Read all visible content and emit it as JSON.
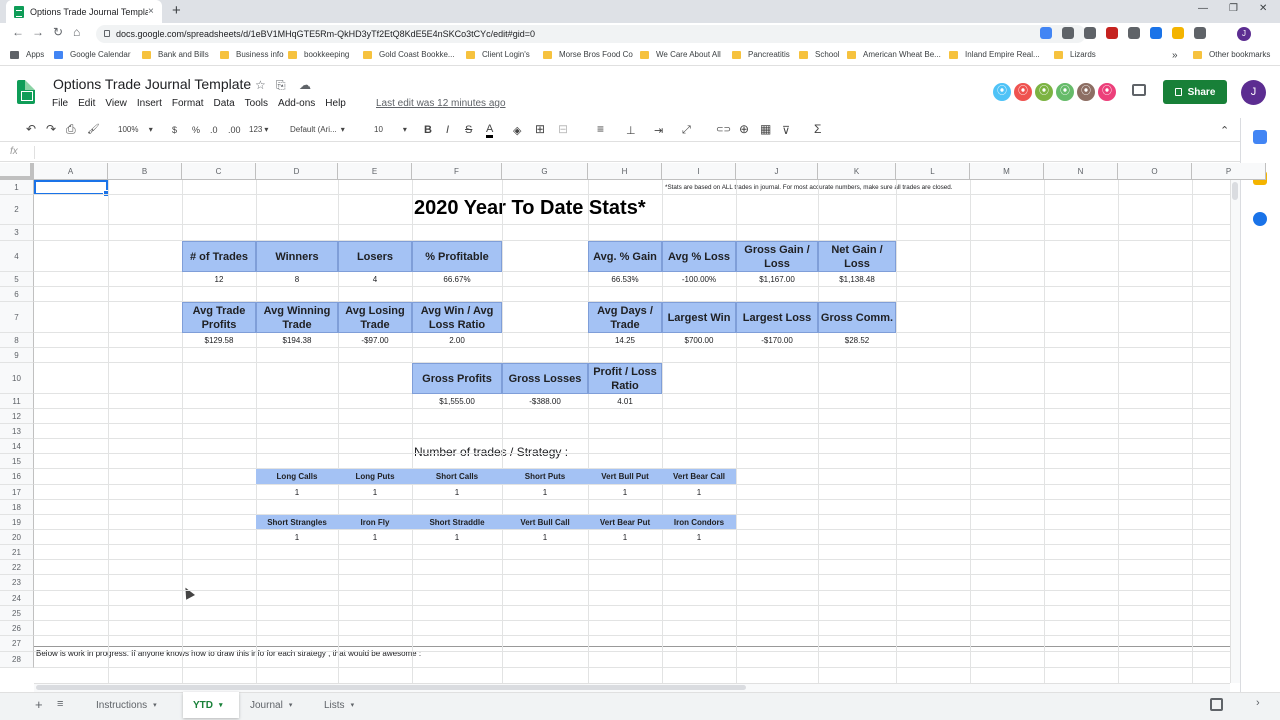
{
  "browser": {
    "tab_title": "Options Trade Journal Template",
    "tab_close": "×",
    "new_tab": "+",
    "win_controls": [
      "—",
      "❐",
      "✕"
    ],
    "nav": [
      "←",
      "→",
      "↻",
      "⌂"
    ],
    "url": "docs.google.com/spreadsheets/d/1eBV1MHqGTE5Rm-QkHD3yTf2EtQ8KdE5E4nSKCo3tCYc/edit#gid=0",
    "extension_colors": [
      "#4285f4",
      "#5f6368",
      "#5f6368",
      "#c5221f",
      "#5f6368",
      "#1a73e8",
      "#f4b400",
      "#5f6368"
    ],
    "profile_initial": "J",
    "bookmarks": [
      "Apps",
      "Google Calendar",
      "Bank and Bills",
      "Business info",
      "bookkeeping",
      "Gold Coast Bookke...",
      "Client Login's",
      "Morse Bros Food Co",
      "We Care About All",
      "Pancreatitis",
      "School",
      "American Wheat Be...",
      "Inland Empire Real...",
      "Lizards"
    ],
    "bookmarks_more": "»",
    "other_bookmarks": "Other bookmarks"
  },
  "sheets": {
    "doc_title": "Options Trade Journal Template",
    "title_icons": [
      "☆",
      "⎘",
      "☁"
    ],
    "menus": [
      "File",
      "Edit",
      "View",
      "Insert",
      "Format",
      "Data",
      "Tools",
      "Add-ons",
      "Help"
    ],
    "last_edit": "Last edit was 12 minutes ago",
    "share_label": "Share",
    "user_initial": "J",
    "collaborator_colors": [
      "#4fc3f7",
      "#ef5350",
      "#7cb342",
      "#66bb6a",
      "#8d6e63",
      "#ec407a"
    ],
    "collaborator_glyphs": [
      "⦿",
      "⦿",
      "⦿",
      "⦿",
      "⦿",
      "⦿"
    ],
    "toolbar": {
      "undo": "↶",
      "redo": "↷",
      "print": "⎙",
      "paint": "🖌",
      "zoom": "100%",
      "currency": "$",
      "percent": "%",
      "dec_less": ".0",
      "dec_more": ".00",
      "format_more": "123",
      "font": "Default (Ari...",
      "font_size": "10",
      "bold": "B",
      "italic": "I",
      "strike": "S",
      "text_color": "A",
      "fill": "◈",
      "borders": "⊞",
      "merge": "⊟",
      "halign": "≡",
      "valign": "⊥",
      "wrap": "⇥",
      "rotate": "⤢",
      "link": "⊂⊃",
      "comment": "⊕",
      "chart": "▦",
      "filter": "⊽",
      "functions": "Σ",
      "dropdown": "▾",
      "collapse": "⌃"
    },
    "formula_label": "fx",
    "columns": [
      "A",
      "B",
      "C",
      "D",
      "E",
      "F",
      "G",
      "H",
      "I",
      "J",
      "K",
      "L",
      "M",
      "N",
      "O",
      "P"
    ],
    "rows": [
      "1",
      "2",
      "3",
      "4",
      "5",
      "6",
      "7",
      "8",
      "9",
      "10",
      "11",
      "12",
      "13",
      "14",
      "15",
      "16",
      "17",
      "18",
      "19",
      "20",
      "21",
      "22",
      "23",
      "24",
      "25",
      "26",
      "27",
      "28"
    ],
    "note": "*Stats are based on ALL trades in journal. For most accurate numbers, make sure all trades are closed.",
    "title": "2020 Year To Date Stats*",
    "stats_row1": {
      "headers": [
        "# of Trades",
        "Winners",
        "Losers",
        "% Profitable"
      ],
      "values": [
        "12",
        "8",
        "4",
        "66.67%"
      ]
    },
    "stats_row1b": {
      "headers": [
        "Avg. % Gain",
        "Avg % Loss",
        "Gross Gain / Loss",
        "Net Gain / Loss"
      ],
      "values": [
        "66.53%",
        "-100.00%",
        "$1,167.00",
        "$1,138.48"
      ]
    },
    "stats_row2": {
      "headers": [
        "Avg Trade Profits",
        "Avg Winning Trade",
        "Avg Losing Trade",
        "Avg Win / Avg Loss Ratio"
      ],
      "values": [
        "$129.58",
        "$194.38",
        "-$97.00",
        "2.00"
      ]
    },
    "stats_row2b": {
      "headers": [
        "Avg Days / Trade",
        "Largest Win",
        "Largest Loss",
        "Gross Comm."
      ],
      "values": [
        "14.25",
        "$700.00",
        "-$170.00",
        "$28.52"
      ]
    },
    "stats_row3": {
      "headers": [
        "Gross Profits",
        "Gross Losses",
        "Profit / Loss Ratio"
      ],
      "values": [
        "$1,555.00",
        "-$388.00",
        "4.01"
      ]
    },
    "strategy_title": "Number of trades / Strategy :",
    "strategy1": {
      "headers": [
        "Long Calls",
        "Long Puts",
        "Short Calls",
        "Short Puts",
        "Vert Bull Put",
        "Vert Bear Call"
      ],
      "values": [
        "1",
        "1",
        "1",
        "1",
        "1",
        "1"
      ]
    },
    "strategy2": {
      "headers": [
        "Short Strangles",
        "Iron Fly",
        "Short Straddle",
        "Vert Bull Call",
        "Vert Bear Put",
        "Iron Condors"
      ],
      "values": [
        "1",
        "1",
        "1",
        "1",
        "1",
        "1"
      ]
    },
    "wip_note": "Below is work in progress. If anyone knows how to draw this info for each strategy , that would be awesome :",
    "sheet_tabs": [
      "Instructions",
      "YTD",
      "Journal",
      "Lists"
    ],
    "active_tab": "YTD",
    "add_sheet": "+",
    "all_sheets": "≡",
    "tab_caret": "▾",
    "expand": "›",
    "colors": {
      "header_fill": "#a4c2f4",
      "share_green": "#188038",
      "selection": "#1a73e8"
    }
  }
}
